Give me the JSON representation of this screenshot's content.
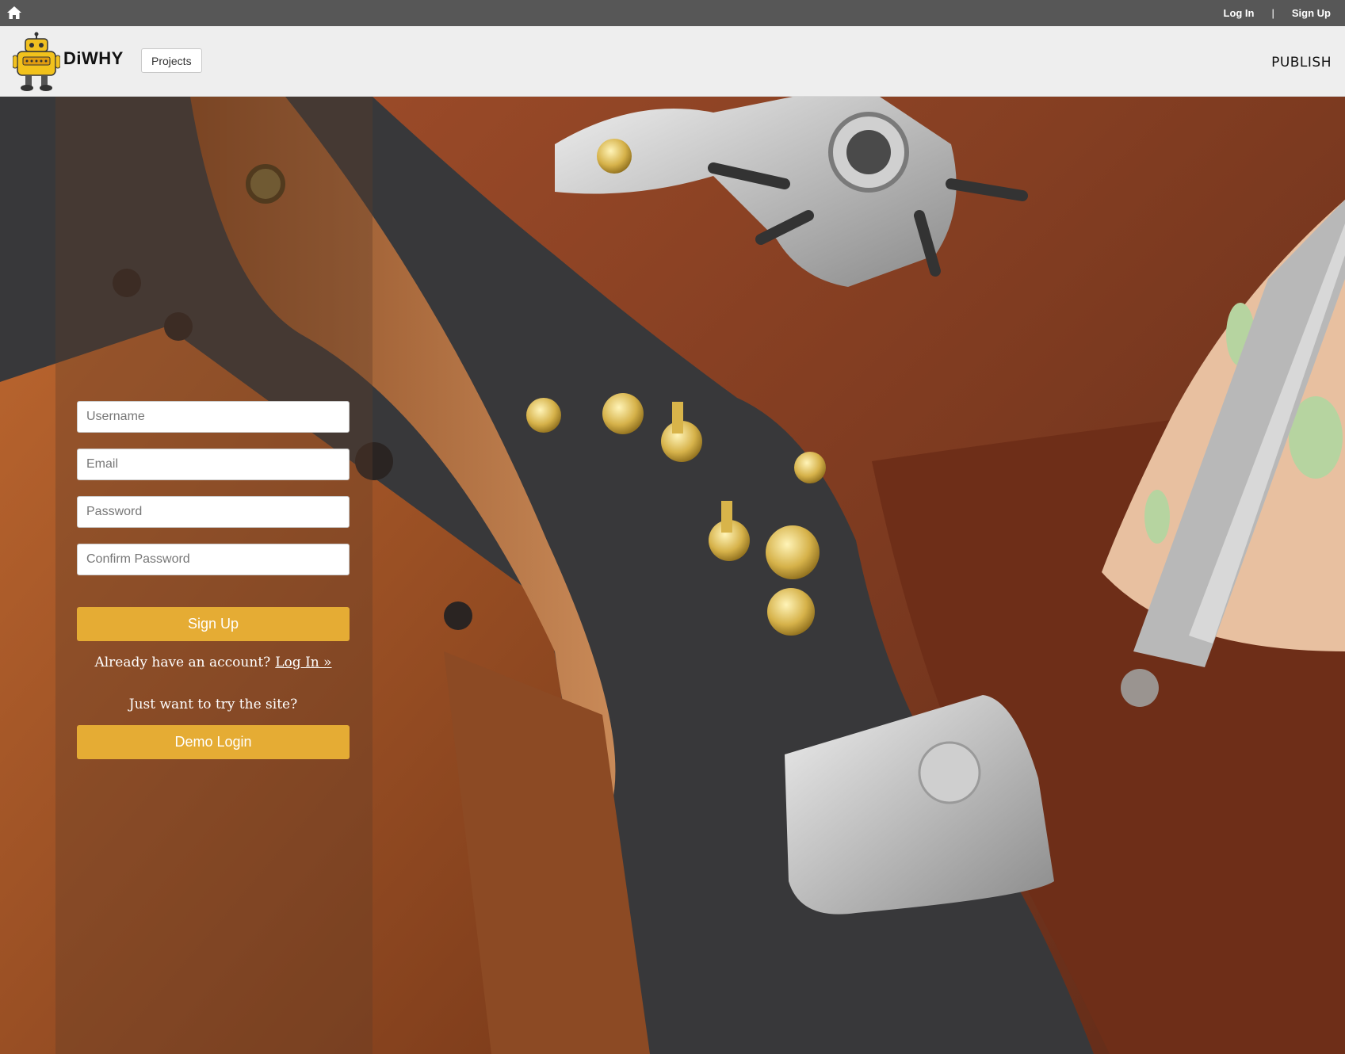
{
  "topbar": {
    "home_icon": "home-icon",
    "login_label": "Log In",
    "separator": "|",
    "signup_label": "Sign Up"
  },
  "header": {
    "brand": "DiWHY",
    "projects_label": "Projects",
    "publish_label": "PUBLISH",
    "logo_icon": "robot-logo"
  },
  "form": {
    "username_placeholder": "Username",
    "email_placeholder": "Email",
    "password_placeholder": "Password",
    "confirm_placeholder": "Confirm Password",
    "signup_button": "Sign Up",
    "have_account_text": "Already have an account?",
    "login_link": "Log In »",
    "try_text": "Just want to try the site?",
    "demo_button": "Demo Login"
  },
  "colors": {
    "topbar": "#575757",
    "header": "#eeeeee",
    "accent": "#e5ac34"
  }
}
